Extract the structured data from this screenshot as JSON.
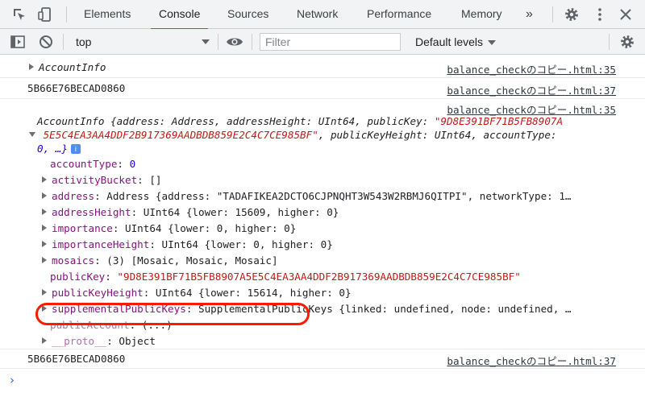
{
  "tabs": [
    "Elements",
    "Console",
    "Sources",
    "Network",
    "Performance",
    "Memory"
  ],
  "toolbar": {
    "context": "top",
    "filter_placeholder": "Filter",
    "levels": "Default levels"
  },
  "icons": {
    "inspect": "inspect-element-icon",
    "device": "device-toggle-icon",
    "more_tabs": "»",
    "settings": "gear-icon",
    "menu": "kebab-menu-icon",
    "close": "close-icon"
  },
  "messages": {
    "m1": {
      "text": "AccountInfo",
      "source": "balance_checkのコピー.html:35"
    },
    "m2": {
      "text": "5B66E76BECAD0860",
      "source": "balance_checkのコピー.html:37"
    },
    "m3": {
      "source": "balance_checkのコピー.html:35",
      "summary1": "AccountInfo {address: Address, addressHeight: UInt64, publicKey: ",
      "summary1_str": "\"9D8E391BF71B5FB8907A",
      "summary2_str": "5E5C4EA3AA4DDF2B917369AADBDB859E2C4C7CE985BF\"",
      "summary2_rest": ", publicKeyHeight: UInt64, accountType:",
      "summary3": "0, …}",
      "props": [
        {
          "key": "accountType",
          "value": "0"
        },
        {
          "key": "activityBucket",
          "value": "[]"
        },
        {
          "key": "address",
          "value": "Address {address: \"TADAFIKEA2DCTO6CJPNQHT3W543W2RBMJ6QITPI\", networkType: 1…"
        },
        {
          "key": "addressHeight",
          "value": "UInt64 {lower: 15609, higher: 0}"
        },
        {
          "key": "importance",
          "value": "UInt64 {lower: 0, higher: 0}"
        },
        {
          "key": "importanceHeight",
          "value": "UInt64 {lower: 0, higher: 0}"
        },
        {
          "key": "mosaics",
          "value": "(3) [Mosaic, Mosaic, Mosaic]"
        },
        {
          "key": "publicKey",
          "value": "\"9D8E391BF71B5FB8907A5E5C4EA3AA4DDF2B917369AADBDB859E2C4C7CE985BF\""
        },
        {
          "key": "publicKeyHeight",
          "value": "UInt64 {lower: 15614, higher: 0}"
        },
        {
          "key": "supplementalPublicKeys",
          "value": "SupplementalPublicKeys {linked: undefined, node: undefined, …"
        },
        {
          "key": "publicAccount",
          "value": "(...)"
        },
        {
          "key": "__proto__",
          "value": "Object"
        }
      ]
    },
    "m4": {
      "text": "5B66E76BECAD0860",
      "source": "balance_checkのコピー.html:37"
    }
  },
  "colors": {
    "accent": "#1a73e8",
    "highlight_ring": "#ff1a00",
    "string": "#c41a16",
    "number": "#1c00cf",
    "key": "#881280"
  }
}
